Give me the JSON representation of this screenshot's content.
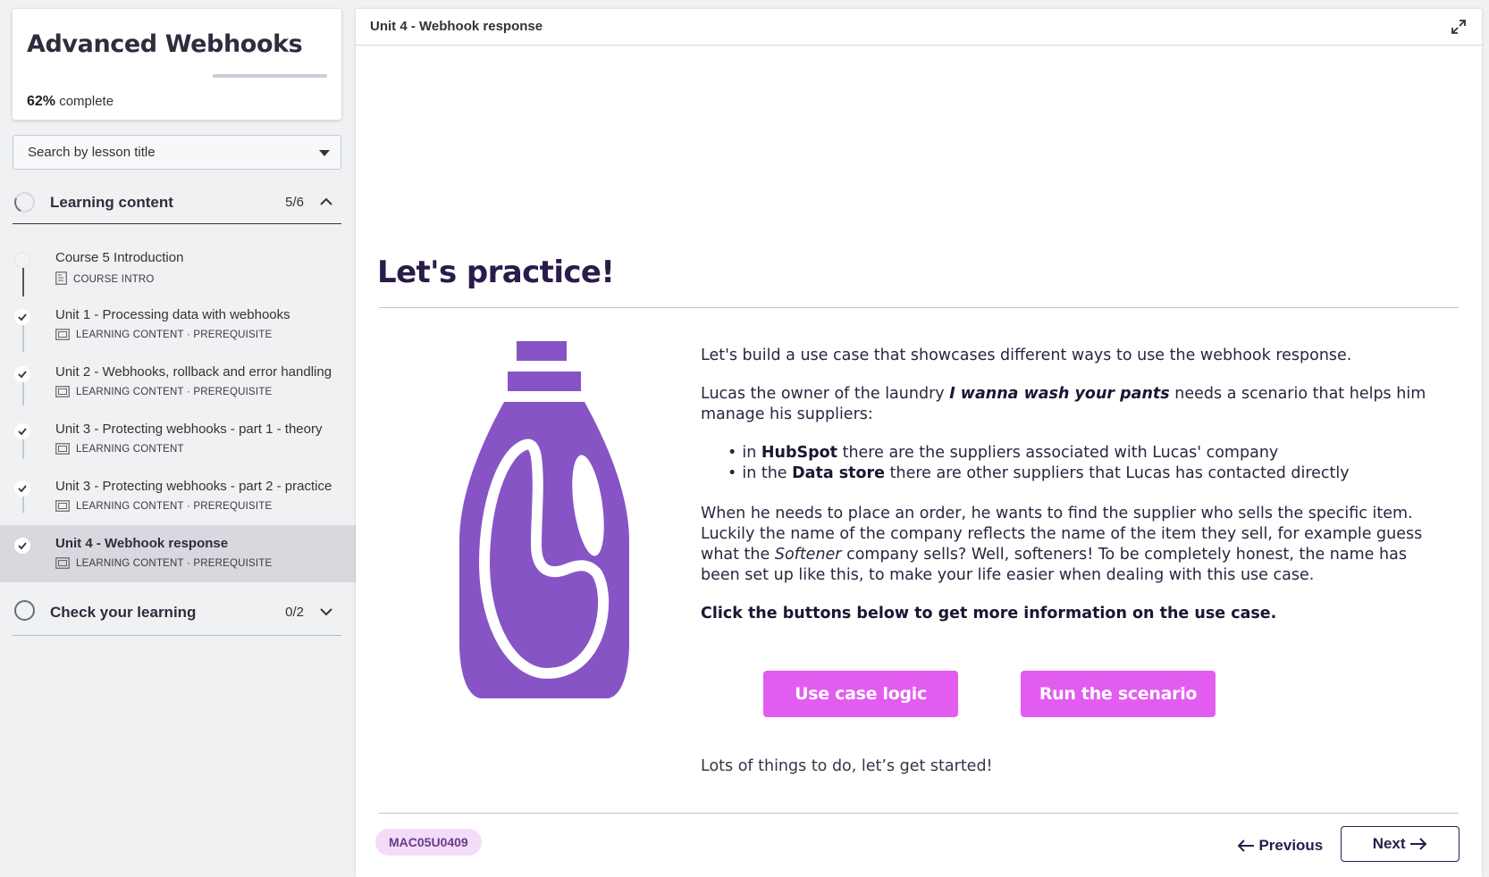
{
  "sidebar": {
    "course_title": "Advanced Webhooks",
    "progress_percent": "62%",
    "progress_suffix": "complete",
    "progress_fraction": 0.62,
    "search_placeholder": "Search by lesson title",
    "sections": [
      {
        "label": "Learning content",
        "count": "5/6",
        "expanded": true
      },
      {
        "label": "Check your learning",
        "count": "0/2",
        "expanded": false
      }
    ],
    "lessons": [
      {
        "name": "Course 5 Introduction",
        "meta": "COURSE INTRO",
        "done": false,
        "icon": "document-icon"
      },
      {
        "name": "Unit 1 - Processing data with webhooks",
        "meta": "LEARNING CONTENT · PREREQUISITE",
        "done": true,
        "icon": "slides-icon"
      },
      {
        "name": "Unit 2 - Webhooks, rollback and error handling",
        "meta": "LEARNING CONTENT · PREREQUISITE",
        "done": true,
        "icon": "slides-icon"
      },
      {
        "name": "Unit 3 - Protecting webhooks - part 1 - theory",
        "meta": "LEARNING CONTENT",
        "done": true,
        "icon": "slides-icon"
      },
      {
        "name": "Unit 3 - Protecting webhooks - part 2 - practice",
        "meta": "LEARNING CONTENT · PREREQUISITE",
        "done": true,
        "icon": "slides-icon"
      },
      {
        "name": "Unit 4 - Webhook response",
        "meta": "LEARNING CONTENT · PREREQUISITE",
        "done": true,
        "active": true,
        "icon": "slides-icon"
      }
    ]
  },
  "main": {
    "header_title": "Unit 4 - Webhook response",
    "heading": "Let's practice!",
    "intro": "Let's build a use case that showcases different ways to use the webhook response.",
    "para2_pre": "Lucas the owner of the laundry ",
    "para2_em": "I wanna wash your pants",
    "para2_post": " needs a scenario that helps him manage his suppliers:",
    "bullet1_pre": "in ",
    "bullet1_bold": "HubSpot",
    "bullet1_post": " there are the suppliers associated with Lucas' company",
    "bullet2_pre": "in the ",
    "bullet2_bold": "Data store",
    "bullet2_post": " there are other suppliers that Lucas has contacted directly",
    "para3_pre": "When he needs to place an order, he wants to find the supplier who sells the specific item. Luckily the name of the company reflects the name of the item they sell, for example guess what the ",
    "para3_em": "Softener",
    "para3_post": " company sells? Well, softeners! To be completely honest, the name has been set up like this, to make your life easier when dealing with this use case.",
    "cta": "Click the buttons below to get more information on the use case.",
    "button_logic": "Use case logic",
    "button_run": "Run the scenario",
    "closing": "Lots of things to do, let’s get started!",
    "lesson_code": "MAC05U0409",
    "prev_label": "Previous",
    "next_label": "Next"
  },
  "colors": {
    "accent_button": "#e35cf0",
    "bottle": "#8754c6",
    "heading": "#2a1b4a",
    "chip_bg": "#f3dcf7"
  }
}
